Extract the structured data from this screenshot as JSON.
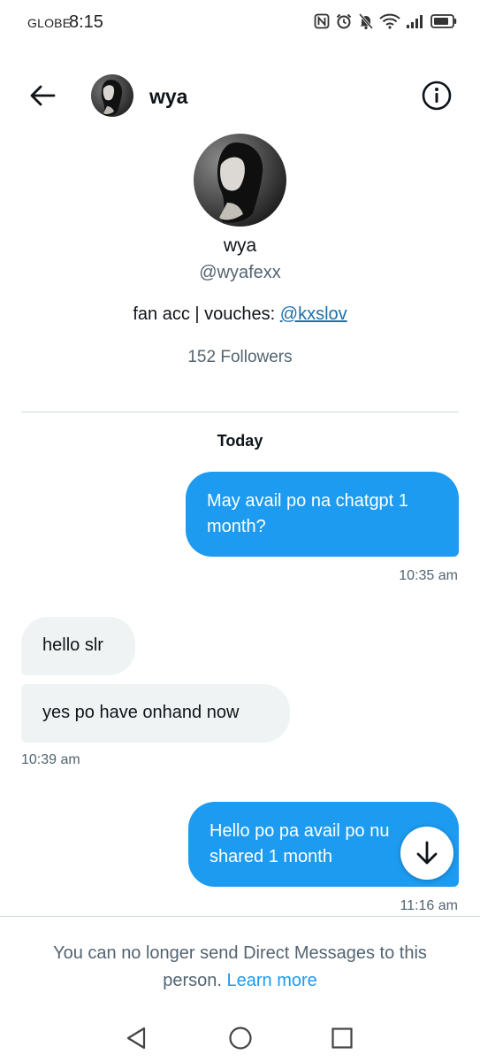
{
  "status_bar": {
    "carrier": "GLOBE",
    "time": "8:15",
    "icons": [
      "nfc-icon",
      "alarm-icon",
      "mute-bell-icon",
      "wifi-icon",
      "signal-icon",
      "battery-icon"
    ]
  },
  "header": {
    "name": "wya",
    "back_icon": "arrow-left-icon",
    "info_icon": "info-icon"
  },
  "profile": {
    "name": "wya",
    "handle": "@wyafexx",
    "bio_text": "fan acc | vouches: ",
    "bio_link": "@kxslov",
    "followers": "152 Followers"
  },
  "conversation": {
    "day_label": "Today",
    "messages": [
      {
        "direction": "sent",
        "text": "May avail po na chatgpt 1 month?",
        "time": "10:35 am"
      },
      {
        "direction": "received",
        "text": "hello slr"
      },
      {
        "direction": "received",
        "text": "yes po have onhand now",
        "time": "10:39 am"
      },
      {
        "direction": "sent",
        "text_line1": "Hello po pa avail po nu",
        "text_line2": "shared 1 month",
        "time": "11:16 am"
      }
    ]
  },
  "footer": {
    "notice_text": "You can no longer send Direct Messages to this person. ",
    "notice_link": "Learn more"
  },
  "nav": {
    "icons": [
      "nav-back-icon",
      "nav-home-icon",
      "nav-recents-icon"
    ]
  },
  "colors": {
    "accent": "#1d9bf0",
    "sent_bubble": "#1d9bf0",
    "received_bubble": "#eff3f4",
    "secondary_text": "#536471"
  }
}
